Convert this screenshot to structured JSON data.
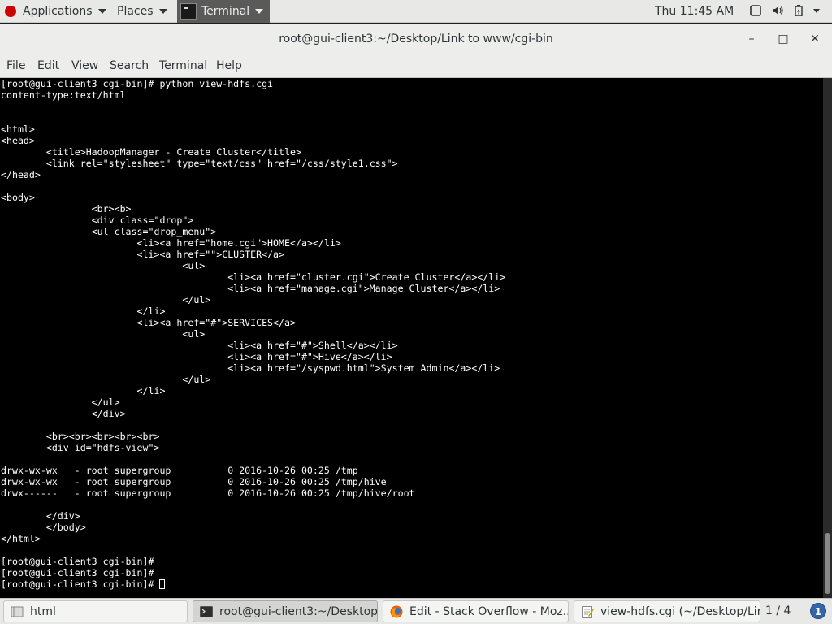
{
  "top_panel": {
    "applications": "Applications",
    "places": "Places",
    "terminal": "Terminal",
    "clock": "Thu 11:45 AM"
  },
  "window": {
    "title": "root@gui-client3:~/Desktop/Link to www/cgi-bin",
    "minimize": "–",
    "maximize": "□",
    "close": "✕"
  },
  "menubar": {
    "items": [
      "File",
      "Edit",
      "View",
      "Search",
      "Terminal",
      "Help"
    ]
  },
  "terminal": {
    "output": "[root@gui-client3 cgi-bin]# python view-hdfs.cgi\ncontent-type:text/html\n\n\n<html>\n<head>\n        <title>HadoopManager - Create Cluster</title>\n        <link rel=\"stylesheet\" type=\"text/css\" href=\"/css/style1.css\">\n</head>\n\n<body>\n                <br><b>\n                <div class=\"drop\">\n                <ul class=\"drop_menu\">\n                        <li><a href=\"home.cgi\">HOME</a></li>\n                        <li><a href=\"\">CLUSTER</a>\n                                <ul>\n                                        <li><a href=\"cluster.cgi\">Create Cluster</a></li>\n                                        <li><a href=\"manage.cgi\">Manage Cluster</a></li>\n                                </ul>\n                        </li>\n                        <li><a href=\"#\">SERVICES</a>\n                                <ul>\n                                        <li><a href=\"#\">Shell</a></li>\n                                        <li><a href=\"#\">Hive</a></li>\n                                        <li><a href=\"/syspwd.html\">System Admin</a></li>\n                                </ul>\n                        </li>\n                </ul>\n                </div>\n\n        <br><br><br><br><br>\n        <div id=\"hdfs-view\">\n\ndrwx-wx-wx   - root supergroup          0 2016-10-26 00:25 /tmp\ndrwx-wx-wx   - root supergroup          0 2016-10-26 00:25 /tmp/hive\ndrwx------   - root supergroup          0 2016-10-26 00:25 /tmp/hive/root\n\n        </div>\n        </body>\n</html>\n\n[root@gui-client3 cgi-bin]#\n[root@gui-client3 cgi-bin]#",
    "prompt": "[root@gui-client3 cgi-bin]# "
  },
  "taskbar": {
    "tasks": [
      "html",
      "root@gui-client3:~/Desktop...",
      "Edit - Stack Overflow - Moz...",
      "view-hdfs.cgi (~/Desktop/Lin..."
    ],
    "workspace": "1 / 4",
    "info_badge": "1"
  }
}
